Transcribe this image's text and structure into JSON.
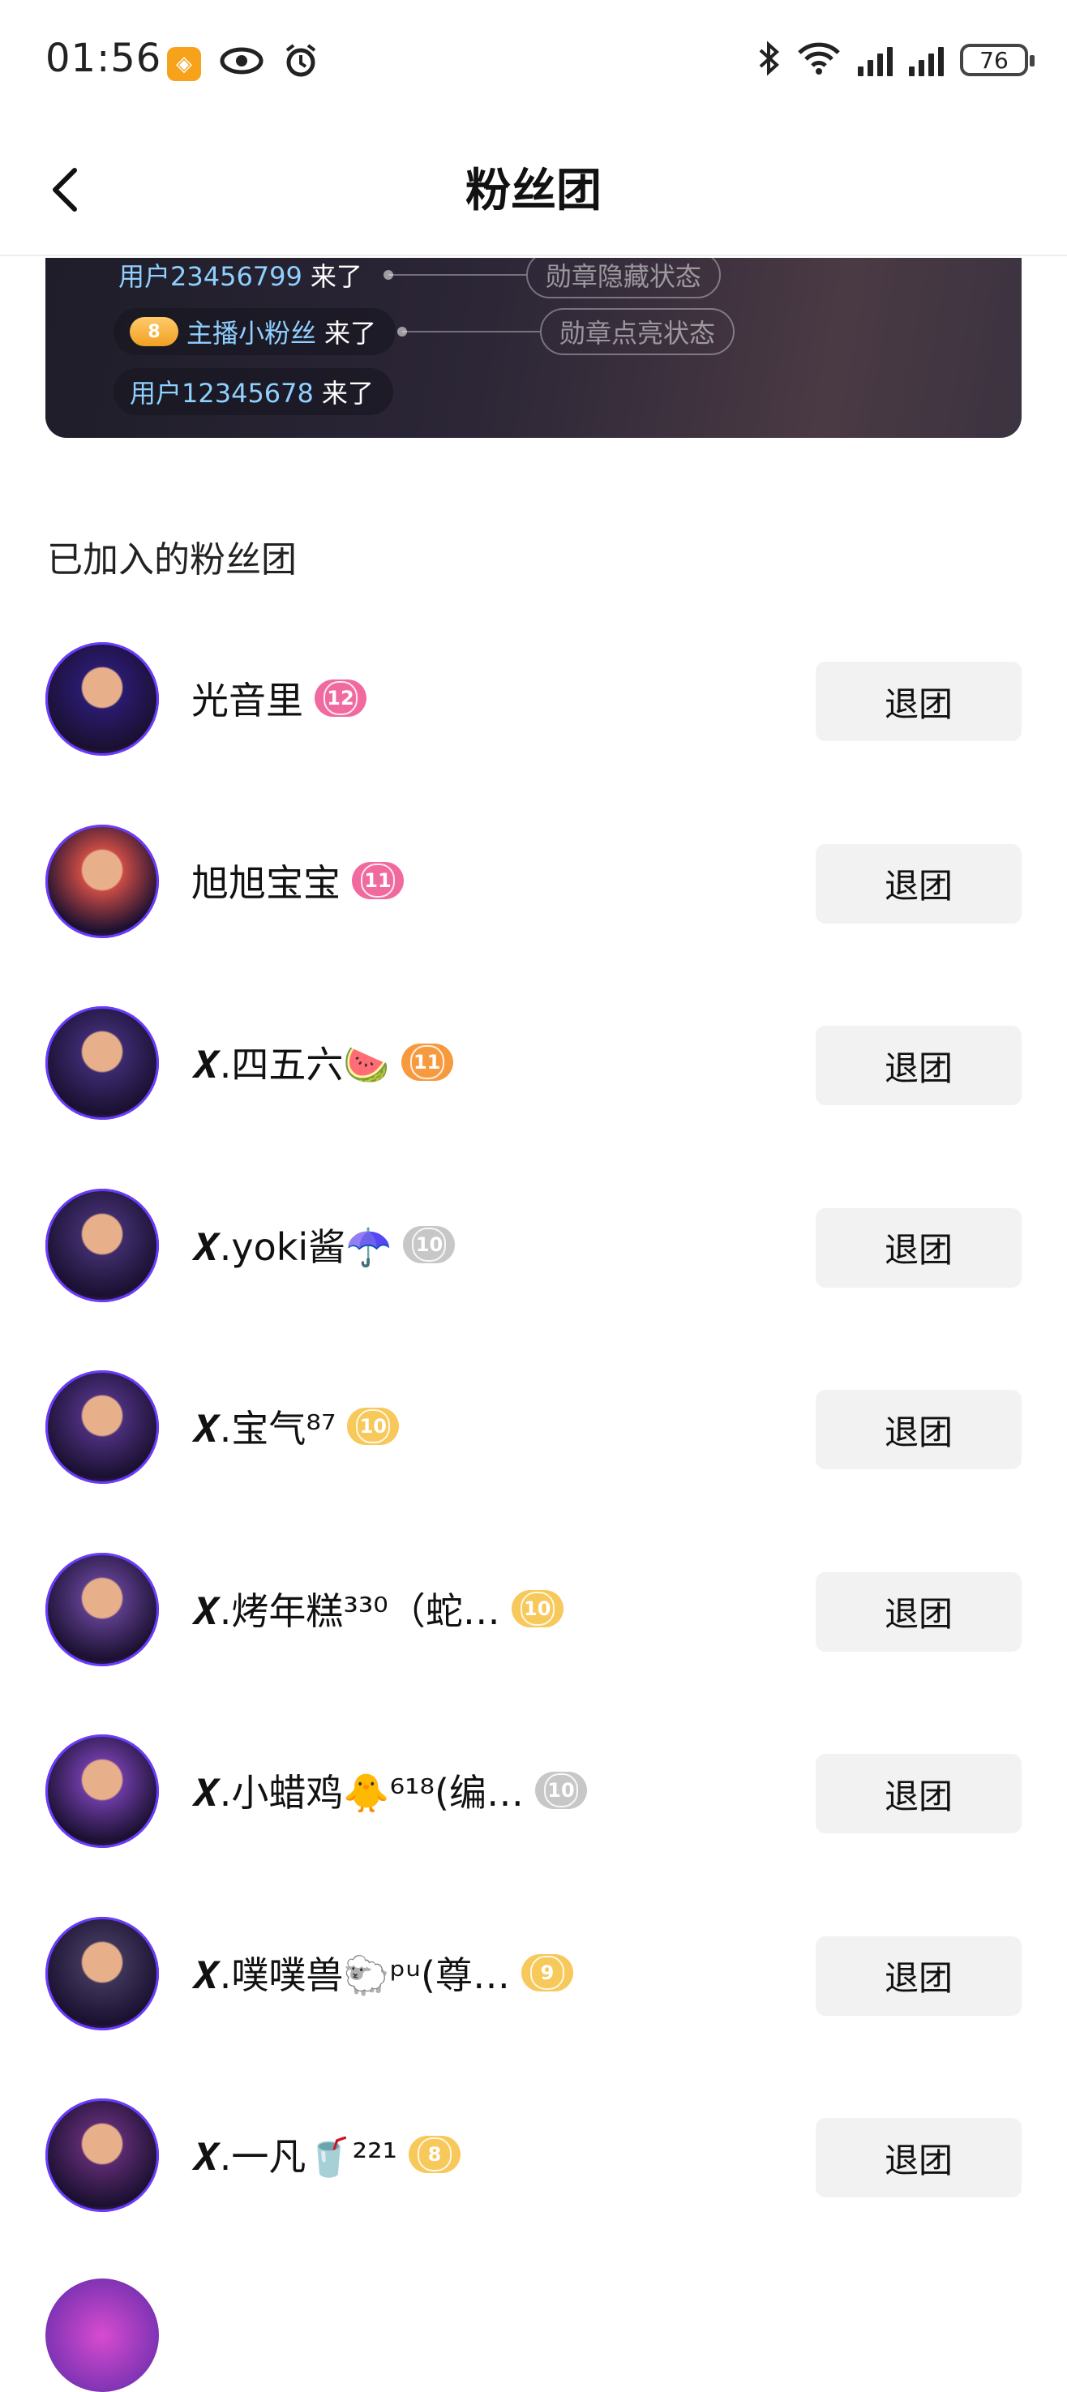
{
  "status_bar": {
    "time": "01:56",
    "battery": "76"
  },
  "nav": {
    "title": "粉丝团"
  },
  "preview": {
    "rows": [
      {
        "name": "用户23456799",
        "suffix": " 来了",
        "tag": "勋章隐藏状态",
        "mini_badge": ""
      },
      {
        "name": "主播小粉丝",
        "suffix": " 来了",
        "tag": "勋章点亮状态",
        "mini_badge": "8"
      },
      {
        "name": "用户12345678",
        "suffix": " 来了",
        "tag": "",
        "mini_badge": ""
      }
    ]
  },
  "section_title": "已加入的粉丝团",
  "leave_label": "退团",
  "colors": {
    "badge_pink": "#f06aa0",
    "badge_orange": "#f79a3e",
    "badge_gray": "#c7c7c7",
    "badge_gold": "#f7c85a"
  },
  "groups": [
    {
      "name": "光音里",
      "level": "12",
      "badge_color": "#f06aa0",
      "avatar": "#2a1a6e"
    },
    {
      "name": "旭旭宝宝",
      "level": "11",
      "badge_color": "#f06aa0",
      "avatar": "#c94b45"
    },
    {
      "name": "𝑿.四五六🍉",
      "level": "11",
      "badge_color": "#f79a3e",
      "avatar": "#3b2a6e"
    },
    {
      "name": "𝑿.yoki酱☂️",
      "level": "10",
      "badge_color": "#c7c7c7",
      "avatar": "#3e2c6a"
    },
    {
      "name": "𝑿.宝气⁸⁷",
      "level": "10",
      "badge_color": "#f7c85a",
      "avatar": "#4a2e7a"
    },
    {
      "name": "𝑿.烤年糕³³⁰（蛇…",
      "level": "10",
      "badge_color": "#f7c85a",
      "avatar": "#5a3c88"
    },
    {
      "name": "𝑿.小蜡鸡🐥⁶¹⁸(编…",
      "level": "10",
      "badge_color": "#c7c7c7",
      "avatar": "#6a3aa0"
    },
    {
      "name": "𝑿.噗噗兽🐑ᵖᵘ(尊…",
      "level": "9",
      "badge_color": "#f7c85a",
      "avatar": "#3d3458"
    },
    {
      "name": "𝑿.一凡🥤²²¹",
      "level": "8",
      "badge_color": "#f7c85a",
      "avatar": "#5a2a6e"
    }
  ]
}
